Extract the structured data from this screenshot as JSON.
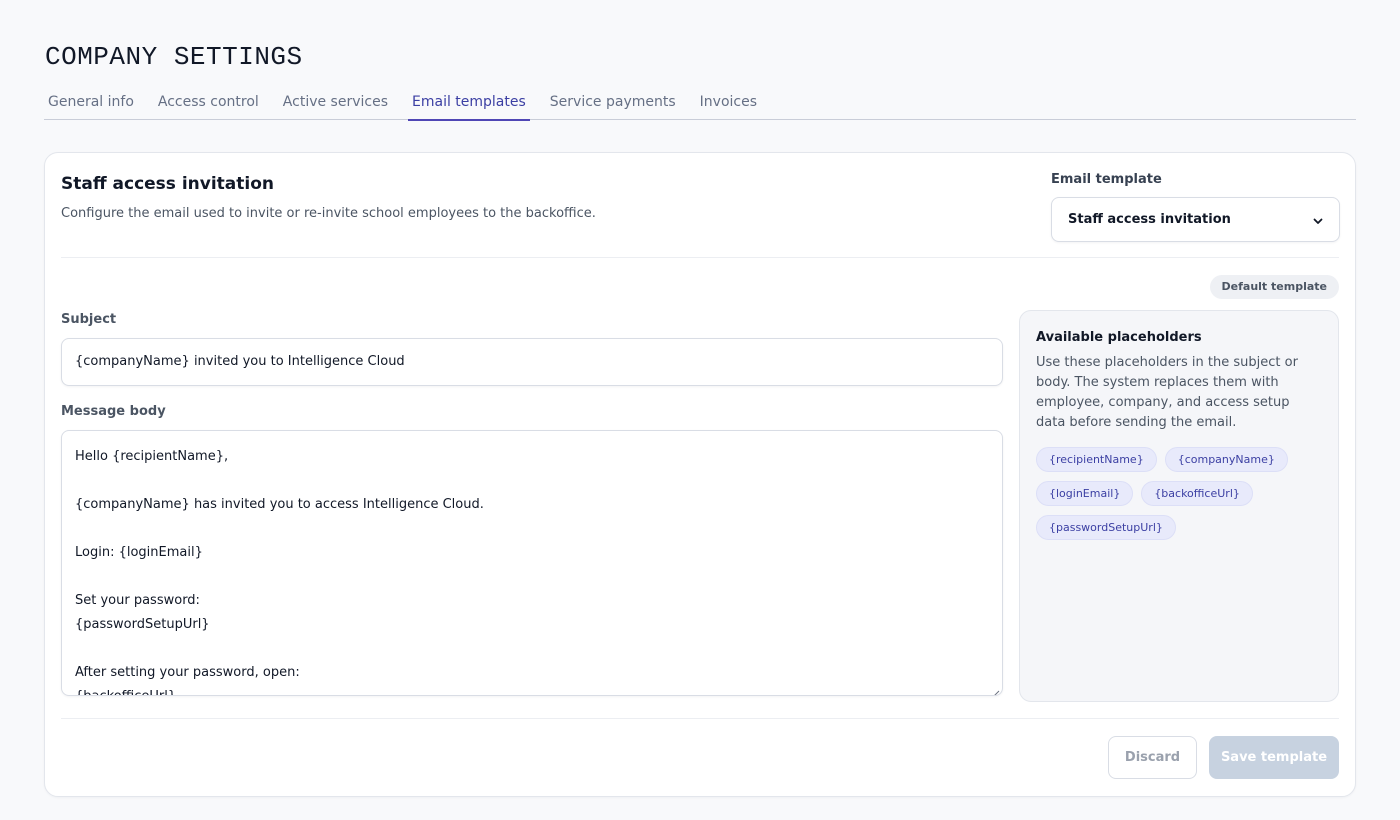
{
  "page": {
    "title": "COMPANY SETTINGS"
  },
  "tabs": [
    {
      "label": "General info",
      "active": false
    },
    {
      "label": "Access control",
      "active": false
    },
    {
      "label": "Active services",
      "active": false
    },
    {
      "label": "Email templates",
      "active": true
    },
    {
      "label": "Service payments",
      "active": false
    },
    {
      "label": "Invoices",
      "active": false
    }
  ],
  "card": {
    "title": "Staff access invitation",
    "description": "Configure the email used to invite or re-invite school employees to the backoffice.",
    "template_select": {
      "label": "Email template",
      "value": "Staff access invitation",
      "icon": "chevron-down-icon"
    },
    "badge": "Default template",
    "subject": {
      "label": "Subject",
      "value": "{companyName} invited you to Intelligence Cloud"
    },
    "body": {
      "label": "Message body",
      "lines": [
        "Hello {recipientName},",
        "",
        "{companyName} has invited you to access Intelligence Cloud.",
        "",
        "Login: {loginEmail}",
        "",
        "Set your password:",
        "{passwordSetupUrl}",
        "",
        "After setting your password, open:",
        "{backofficeUrl}"
      ]
    },
    "placeholders": {
      "title": "Available placeholders",
      "description": "Use these placeholders in the subject or body. The system replaces them with employee, company, and access setup data before sending the email.",
      "items": [
        "{recipientName}",
        "{companyName}",
        "{loginEmail}",
        "{backofficeUrl}",
        "{passwordSetupUrl}"
      ]
    },
    "actions": {
      "discard": "Discard",
      "save": "Save template"
    }
  },
  "colors": {
    "accent": "#4f46b5",
    "chip_bg": "#e8eafb",
    "save_disabled": "#c7d2e0"
  }
}
